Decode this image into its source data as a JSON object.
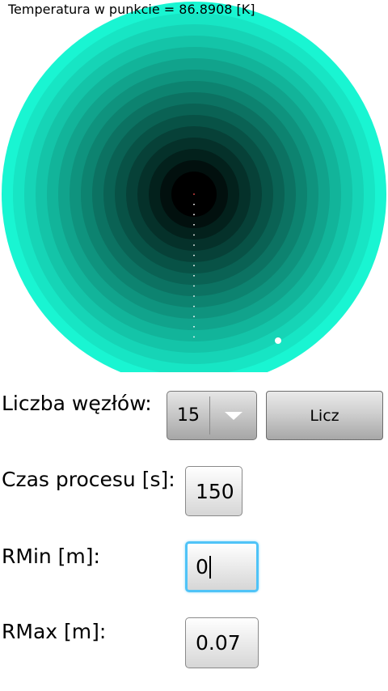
{
  "header": {
    "text": "Temperatura w punkcie = 86.8908 [K]"
  },
  "visualization": {
    "outer_color": "#19f5d2",
    "inner_color": "#000000",
    "ring_count": 15,
    "marker_color": "#ffffff"
  },
  "form": {
    "nodes_label": "Liczba węzłów:",
    "nodes_value": "15",
    "calc_button": "Licz",
    "time_label": "Czas procesu [s]:",
    "time_value": "150",
    "rmin_label": "RMin [m]:",
    "rmin_value": "0",
    "rmax_label": "RMax [m]:",
    "rmax_value": "0.07"
  }
}
